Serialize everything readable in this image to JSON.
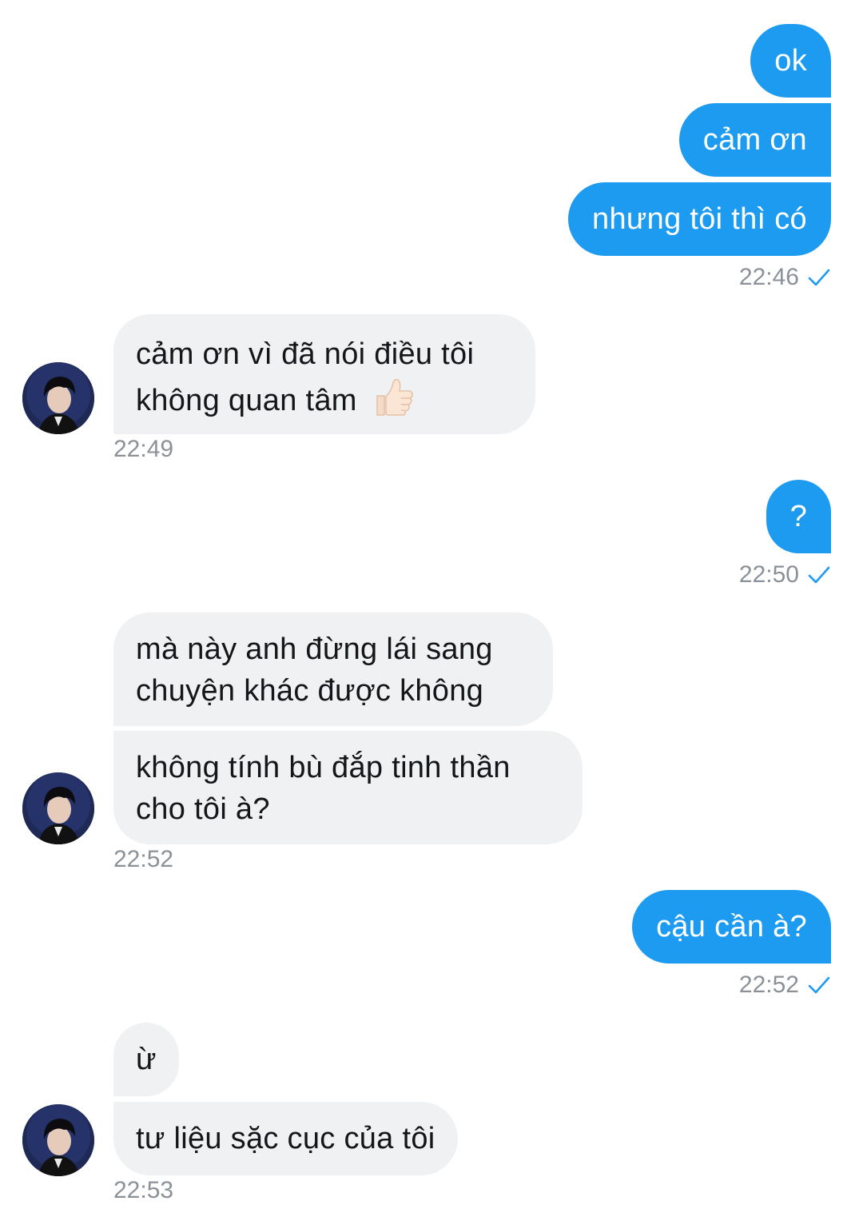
{
  "messages": {
    "m1": "ok",
    "m2": "cảm ơn",
    "m3": "nhưng tôi thì có",
    "t1": "22:46",
    "m4_line1": "cảm ơn vì đã nói điều tôi",
    "m4_line2": "không quan tâm",
    "t2": "22:49",
    "m5": "?",
    "t3": "22:50",
    "m6_line1": "mà này anh đừng lái sang",
    "m6_line2": "chuyện khác được không",
    "m7_line1": "không tính bù đắp tinh thần",
    "m7_line2": "cho tôi à?",
    "t4": "22:52",
    "m8": "cậu cần à?",
    "t5": "22:52",
    "m9": "ừ",
    "m10": "tư liệu sặc cục của tôi",
    "t6": "22:53"
  },
  "icons": {
    "read_check": "checkmark-icon",
    "thumbs_up": "thumbs-up-emoji",
    "avatar": "contact-avatar"
  },
  "colors": {
    "outgoing_bubble": "#1d9bf0",
    "incoming_bubble": "#eff1f3",
    "timestamp": "#8b9198",
    "check": "#1d9bf0"
  }
}
